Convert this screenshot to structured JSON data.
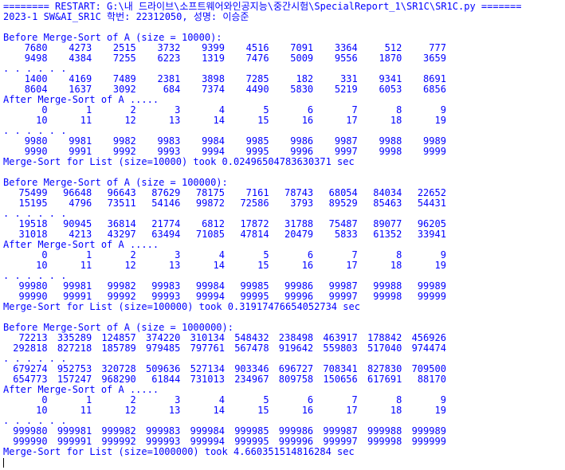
{
  "restart_line": "======== RESTART: G:\\내 드라이브\\소프트웨어와인공지능\\중간시험\\SpecialReport_1\\SR1C\\SR1C.py =======",
  "header_line": "2023-1 SW&AI_SR1C 학번: 22312050, 성명: 이승준",
  "blocks": [
    {
      "before_label": "Before Merge-Sort of A (size = 10000):",
      "before_rows": [
        [
          "7680",
          "4273",
          "2515",
          "3732",
          "9399",
          "4516",
          "7091",
          "3364",
          "512",
          "777"
        ],
        [
          "9498",
          "4384",
          "7255",
          "6223",
          "1319",
          "7476",
          "5009",
          "9556",
          "1870",
          "3659"
        ]
      ],
      "dots": ". . . . . .",
      "before_tail_rows": [
        [
          "1400",
          "4169",
          "7489",
          "2381",
          "3898",
          "7285",
          "182",
          "331",
          "9341",
          "8691"
        ],
        [
          "8604",
          "1637",
          "3092",
          "684",
          "7374",
          "4490",
          "5830",
          "5219",
          "6053",
          "6856"
        ]
      ],
      "after_label": "After Merge-Sort of A .....",
      "after_rows": [
        [
          "0",
          "1",
          "2",
          "3",
          "4",
          "5",
          "6",
          "7",
          "8",
          "9"
        ],
        [
          "10",
          "11",
          "12",
          "13",
          "14",
          "15",
          "16",
          "17",
          "18",
          "19"
        ]
      ],
      "after_tail_rows": [
        [
          "9980",
          "9981",
          "9982",
          "9983",
          "9984",
          "9985",
          "9986",
          "9987",
          "9988",
          "9989"
        ],
        [
          "9990",
          "9991",
          "9992",
          "9993",
          "9994",
          "9995",
          "9996",
          "9997",
          "9998",
          "9999"
        ]
      ],
      "timing": "Merge-Sort for List (size=10000) took 0.02496504783630371 sec"
    },
    {
      "before_label": "Before Merge-Sort of A (size = 100000):",
      "before_rows": [
        [
          "75499",
          "96648",
          "96643",
          "87629",
          "78175",
          "7161",
          "78743",
          "68054",
          "84034",
          "22652"
        ],
        [
          "15195",
          "4796",
          "73511",
          "54146",
          "99872",
          "72586",
          "3793",
          "89529",
          "85463",
          "54431"
        ]
      ],
      "dots": ". . . . . .",
      "before_tail_rows": [
        [
          "19518",
          "90945",
          "36814",
          "21774",
          "6812",
          "17872",
          "31788",
          "75487",
          "89077",
          "96205"
        ],
        [
          "31018",
          "4213",
          "43297",
          "63494",
          "71085",
          "47814",
          "20479",
          "5833",
          "61352",
          "33941"
        ]
      ],
      "after_label": "After Merge-Sort of A .....",
      "after_rows": [
        [
          "0",
          "1",
          "2",
          "3",
          "4",
          "5",
          "6",
          "7",
          "8",
          "9"
        ],
        [
          "10",
          "11",
          "12",
          "13",
          "14",
          "15",
          "16",
          "17",
          "18",
          "19"
        ]
      ],
      "after_tail_rows": [
        [
          "99980",
          "99981",
          "99982",
          "99983",
          "99984",
          "99985",
          "99986",
          "99987",
          "99988",
          "99989"
        ],
        [
          "99990",
          "99991",
          "99992",
          "99993",
          "99994",
          "99995",
          "99996",
          "99997",
          "99998",
          "99999"
        ]
      ],
      "timing": "Merge-Sort for List (size=100000) took 0.31917476654052734 sec"
    },
    {
      "before_label": "Before Merge-Sort of A (size = 1000000):",
      "before_rows": [
        [
          "72213",
          "335289",
          "124857",
          "374220",
          "310134",
          "548432",
          "238498",
          "463917",
          "178842",
          "456926"
        ],
        [
          "292818",
          "827218",
          "185789",
          "979485",
          "797761",
          "567478",
          "919642",
          "559803",
          "517040",
          "974474"
        ]
      ],
      "dots": ". . . . . .",
      "before_tail_rows": [
        [
          "679274",
          "952753",
          "320728",
          "509636",
          "527134",
          "903346",
          "696727",
          "708341",
          "827830",
          "709500"
        ],
        [
          "654773",
          "157247",
          "968290",
          "61844",
          "731013",
          "234967",
          "809758",
          "150656",
          "617691",
          "88170"
        ]
      ],
      "after_label": "After Merge-Sort of A .....",
      "after_rows": [
        [
          "0",
          "1",
          "2",
          "3",
          "4",
          "5",
          "6",
          "7",
          "8",
          "9"
        ],
        [
          "10",
          "11",
          "12",
          "13",
          "14",
          "15",
          "16",
          "17",
          "18",
          "19"
        ]
      ],
      "after_tail_rows": [
        [
          "999980",
          "999981",
          "999982",
          "999983",
          "999984",
          "999985",
          "999986",
          "999987",
          "999988",
          "999989"
        ],
        [
          "999990",
          "999991",
          "999992",
          "999993",
          "999994",
          "999995",
          "999996",
          "999997",
          "999998",
          "999999"
        ]
      ],
      "timing": "Merge-Sort for List (size=1000000) took 4.660351514816284 sec"
    }
  ],
  "colors": {
    "output_text": "#0000ff",
    "background": "#ffffff",
    "cursor": "#000000"
  }
}
